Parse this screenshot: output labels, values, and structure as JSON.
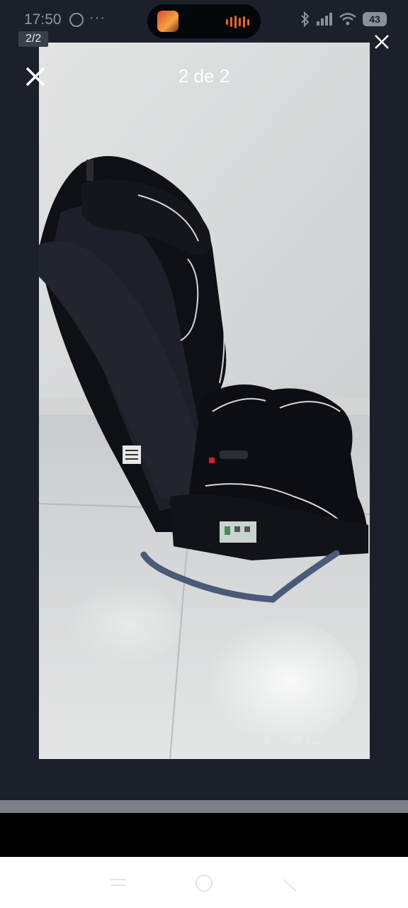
{
  "status_bar": {
    "time": "17:50",
    "battery": "43",
    "icons": [
      "whatsapp-icon",
      "more-dots-icon",
      "bluetooth-icon",
      "signal-icon",
      "wifi-icon",
      "battery-icon"
    ]
  },
  "gallery": {
    "small_counter": "2/2",
    "title": "2 de 2"
  },
  "photo": {
    "timestamp_watermark": "2        28 1…"
  },
  "nav_bar": {
    "buttons": [
      "menu-icon",
      "home-icon",
      "back-icon"
    ]
  },
  "colors": {
    "background": "#1c202b",
    "island": "#05070b",
    "wall": "#d9dcdc",
    "floor": "#cfd1d1",
    "seat": "#101116"
  }
}
